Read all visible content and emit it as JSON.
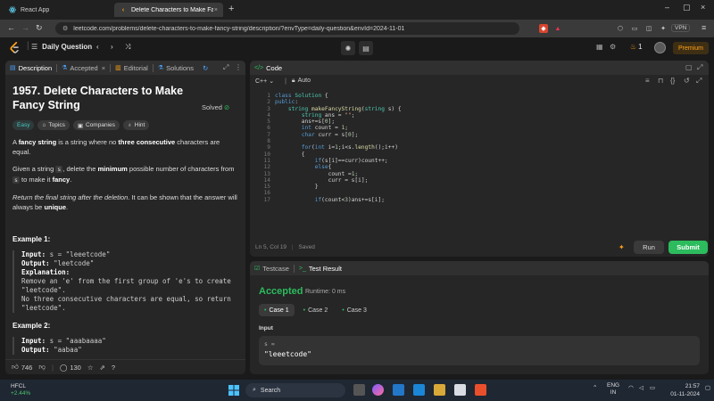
{
  "browser": {
    "tabs": [
      {
        "label": "React App"
      },
      {
        "label": "Delete Characters to Make Fancy"
      }
    ],
    "url": "leetcode.com/problems/delete-characters-to-make-fancy-string/description/?envType=daily-question&envId=2024-11-01",
    "vpn_label": "VPN"
  },
  "lcnav": {
    "daily_question": "Daily Question",
    "streak": "1",
    "premium": "Premium"
  },
  "left_panel": {
    "tabs": [
      "Description",
      "Accepted",
      "Editorial",
      "Solutions"
    ],
    "title": "1957. Delete Characters to Make Fancy String",
    "solved": "Solved",
    "tags": [
      "Easy",
      "Topics",
      "Companies",
      "Hint"
    ],
    "desc": {
      "p1_a": "A ",
      "p1_b": "fancy string",
      "p1_c": " is a string where no ",
      "p1_d": "three consecutive",
      "p1_e": " characters are equal.",
      "p2_a": "Given a string ",
      "p2_s": "s",
      "p2_b": ", delete the ",
      "p2_c": "minimum",
      "p2_d": " possible number of characters from ",
      "p2_e": " to make it ",
      "p2_f": "fancy",
      "p2_g": ".",
      "p3_a": "Return the final string after the deletion",
      "p3_b": ". It can be shown that the answer will always be ",
      "p3_c": "unique",
      "p3_d": "."
    },
    "examples": [
      {
        "title": "Example 1:",
        "input_label": "Input:",
        "input": "s = \"leeetcode\"",
        "output_label": "Output:",
        "output": "\"leetcode\"",
        "explanation_label": "Explanation:",
        "explanation": "Remove an 'e' from the first group of 'e's to create \"leetcode\".\nNo three consecutive characters are equal, so return \"leetcode\"."
      },
      {
        "title": "Example 2:",
        "input_label": "Input:",
        "input": "s = \"aaabaaaa\"",
        "output_label": "Output:",
        "output": "\"aabaa\""
      }
    ],
    "footer": {
      "likes": "746",
      "comments": "130"
    }
  },
  "editor": {
    "header": "Code",
    "language": "C++",
    "mode": "Auto",
    "line_numbers": [
      "1",
      "2",
      "3",
      "4",
      "5",
      "6",
      "7",
      "8",
      "9",
      "10",
      "11",
      "12",
      "13",
      "14",
      "15",
      "16",
      "17"
    ],
    "status": "Ln 5, Col 19",
    "saved": "Saved",
    "run": "Run",
    "submit": "Submit"
  },
  "result": {
    "tabs": [
      "Testcase",
      "Test Result"
    ],
    "verdict": "Accepted",
    "runtime": "Runtime: 0 ms",
    "cases": [
      "Case 1",
      "Case 2",
      "Case 3"
    ],
    "input_label": "Input",
    "var_name": "s =",
    "var_value": "\"leeetcode\""
  },
  "taskbar": {
    "ticker": "HFCL",
    "change": "+2.44%",
    "search": "Search",
    "lang": "ENG",
    "region": "IN",
    "time": "21:57",
    "date": "01-11-2024"
  },
  "colors": {
    "accent_green": "#2cbb5d",
    "leetcode_orange": "#ffa116",
    "easy_teal": "#46c6c2"
  }
}
